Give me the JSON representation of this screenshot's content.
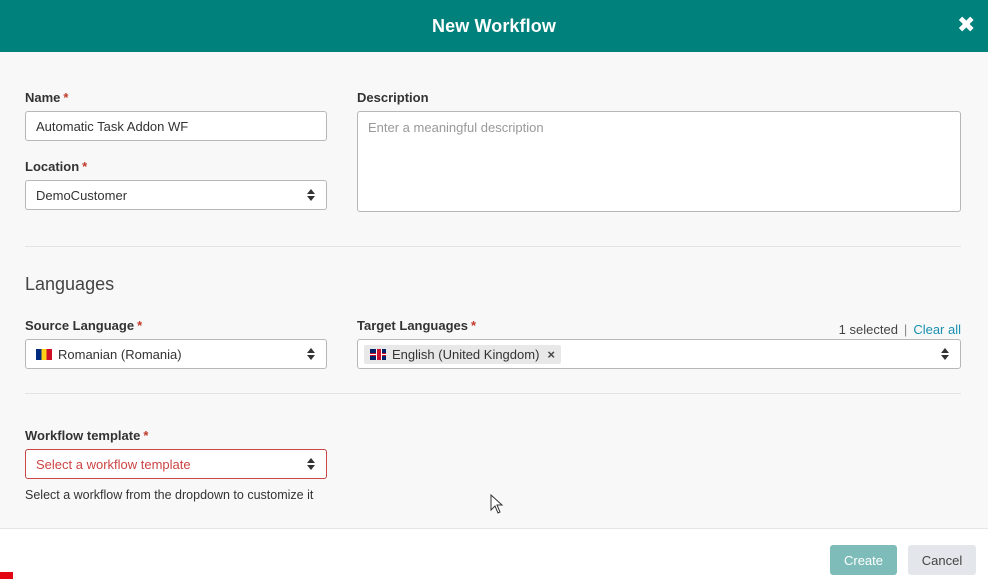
{
  "header": {
    "title": "New Workflow",
    "close_icon": "close-icon"
  },
  "form": {
    "name": {
      "label": "Name",
      "required": "*",
      "value": "Automatic Task Addon WF"
    },
    "location": {
      "label": "Location",
      "required": "*",
      "value": "DemoCustomer"
    },
    "description": {
      "label": "Description",
      "placeholder": "Enter a meaningful description"
    },
    "languages_section": "Languages",
    "source_language": {
      "label": "Source Language",
      "required": "*",
      "value": "Romanian (Romania)",
      "flag": "romania-flag-icon"
    },
    "target_languages": {
      "label": "Target Languages",
      "required": "*",
      "selected_count": "1 selected",
      "separator": "|",
      "clear_all": "Clear all",
      "tags": [
        {
          "label": "English (United Kingdom)",
          "flag": "uk-flag-icon",
          "remove": "×"
        }
      ]
    },
    "workflow_template": {
      "label": "Workflow template",
      "required": "*",
      "placeholder": "Select a workflow template",
      "help": "Select a workflow from the dropdown to customize it"
    }
  },
  "footer": {
    "create_label": "Create",
    "cancel_label": "Cancel"
  },
  "colors": {
    "header": "#00817b",
    "accent_link": "#1a8fb0",
    "required": "#c0392b",
    "create_button": "#7dbcb8",
    "error": "#cc4444"
  }
}
